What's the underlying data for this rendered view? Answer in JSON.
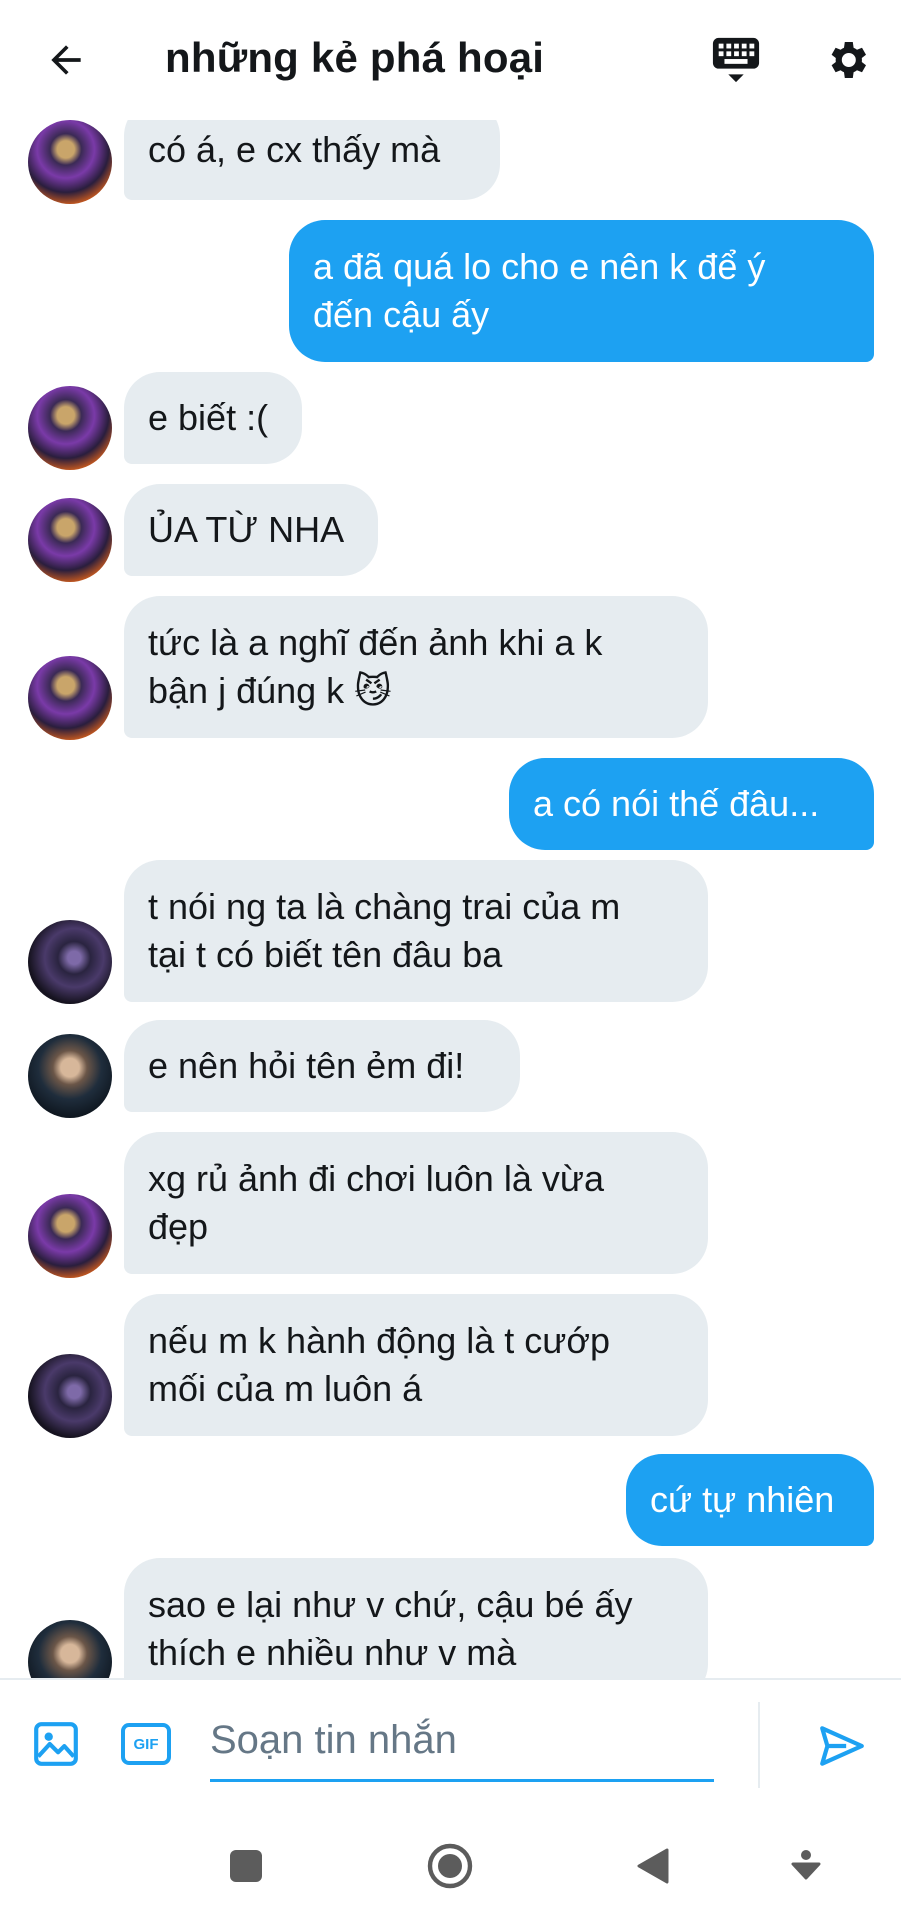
{
  "header": {
    "title": "những kẻ phá hoại",
    "back_icon": "arrow-left-icon",
    "keyboard_icon": "keyboard-icon",
    "settings_icon": "gear-icon"
  },
  "messages": [
    {
      "direction": "in",
      "text": "có á, e cx thấy mà",
      "avatar": "a"
    },
    {
      "direction": "out",
      "text": "a đã quá lo cho e nên k để ý\nđến cậu ấy"
    },
    {
      "direction": "in",
      "text": "e biết :(",
      "avatar": "a"
    },
    {
      "direction": "in",
      "text": "ỦA TỪ NHA",
      "avatar": "a"
    },
    {
      "direction": "in",
      "text": "tức là a nghĩ đến ảnh khi a k\nbận j đúng k 😼",
      "avatar": "a"
    },
    {
      "direction": "out",
      "text": "a có nói thế đâu..."
    },
    {
      "direction": "in",
      "text": "t nói ng ta là chàng trai của m\ntại t có biết tên đâu ba",
      "avatar": "b"
    },
    {
      "direction": "in",
      "text": "e nên hỏi tên ẻm đi!",
      "avatar": "c"
    },
    {
      "direction": "in",
      "text": "xg rủ ảnh đi chơi luôn là vừa\nđẹp",
      "avatar": "a"
    },
    {
      "direction": "in",
      "text": "nếu m k hành động là t cướp\nmối của m luôn á",
      "avatar": "b"
    },
    {
      "direction": "out",
      "text": "cứ tự nhiên"
    },
    {
      "direction": "in",
      "text": "sao e lại như v chứ, cậu bé ấy\nthích e nhiều như v mà",
      "avatar": "c"
    }
  ],
  "composer": {
    "placeholder": "Soạn tin nhắn",
    "image_icon": "image-icon",
    "gif_label": "GIF",
    "send_icon": "send-icon"
  },
  "system_nav": {
    "recents_icon": "square-icon",
    "home_icon": "circle-home-icon",
    "back_icon": "triangle-back-icon",
    "menu_icon": "down-arrow-icon"
  },
  "colors": {
    "accent": "#1da1f2",
    "incoming_bubble": "#e6ecf0",
    "text_primary": "#14171a",
    "placeholder": "#657786"
  }
}
